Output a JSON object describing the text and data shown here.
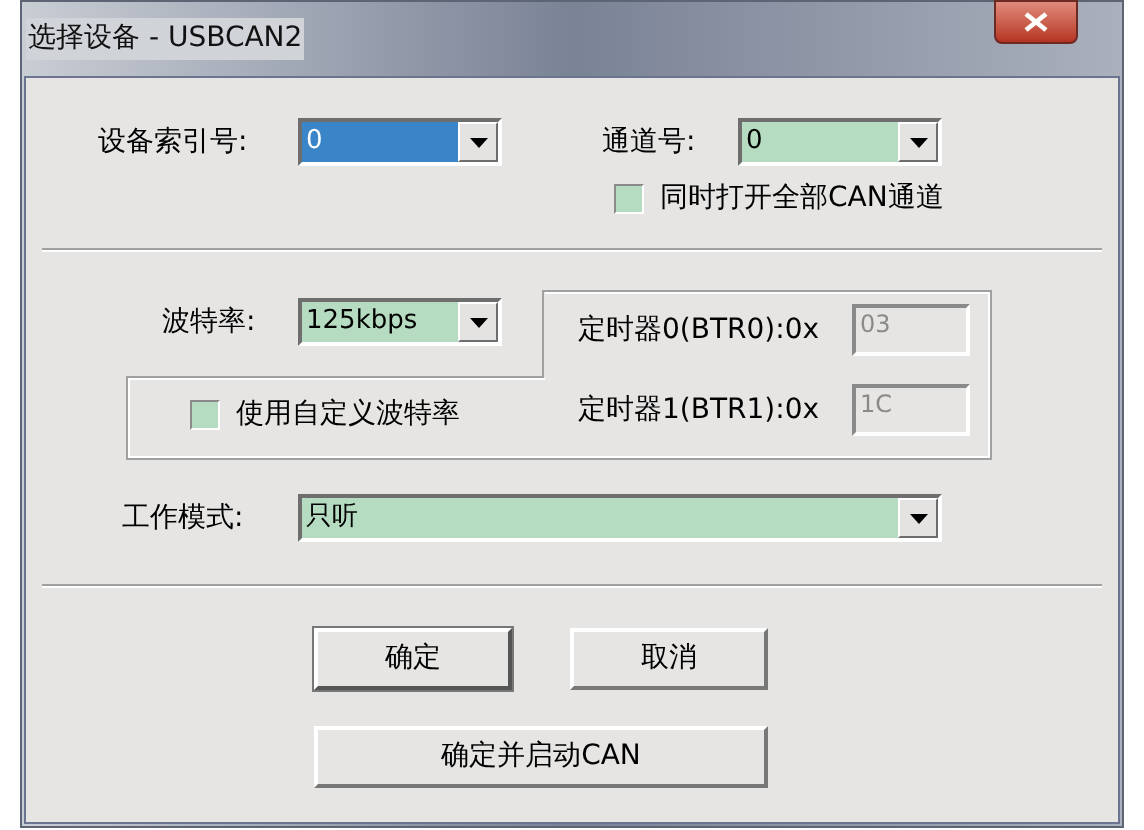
{
  "window": {
    "title": "选择设备 - USBCAN2"
  },
  "device_index": {
    "label": "设备索引号:",
    "value": "0",
    "focused": true
  },
  "channel": {
    "label": "通道号:",
    "value": "0",
    "focused": false
  },
  "open_all_channels": {
    "label": "同时打开全部CAN通道",
    "checked": false
  },
  "baud_rate": {
    "label": "波特率:",
    "value": "125kbps",
    "focused": false
  },
  "custom_baud": {
    "label": "使用自定义波特率",
    "checked": false
  },
  "timers": [
    {
      "label": "定时器0(BTR0):0x",
      "value": "03",
      "disabled": true
    },
    {
      "label": "定时器1(BTR1):0x",
      "value": "1C",
      "disabled": true
    }
  ],
  "work_mode": {
    "label": "工作模式:",
    "value": "只听",
    "focused": false
  },
  "buttons": [
    {
      "label": "确定",
      "default": true
    },
    {
      "label": "取消",
      "default": false
    }
  ],
  "start_button": {
    "label": "确定并启动CAN"
  }
}
